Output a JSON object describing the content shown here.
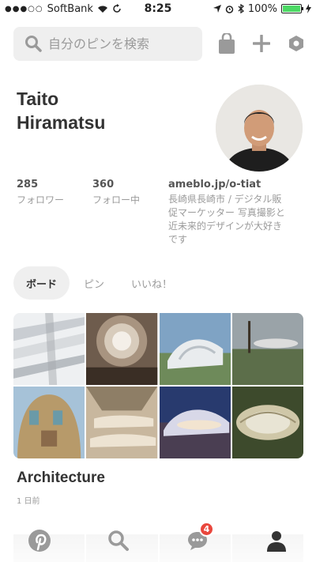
{
  "status_bar": {
    "signal": "●●●○○",
    "carrier": "SoftBank",
    "time": "8:25",
    "battery_percent": "100%",
    "battery_level": 1.0
  },
  "top_bar": {
    "search_placeholder": "自分のピンを検索",
    "icons": [
      "search-icon",
      "bag-icon",
      "plus-icon",
      "settings-hex-icon"
    ]
  },
  "profile": {
    "first_name": "Taito",
    "last_name": "Hiramatsu",
    "followers_count": "285",
    "followers_label": "フォロワー",
    "following_count": "360",
    "following_label": "フォロー中",
    "website": "ameblo.jp/o-tiat",
    "bio_lines": [
      "長崎県長崎市 / デジタル販",
      "促マーケッター 写真撮影と",
      "近未来的デザインが大好き",
      "です"
    ]
  },
  "tabs": [
    {
      "label": "ボード",
      "active": true
    },
    {
      "label": "ピン",
      "active": false
    },
    {
      "label": "いいね！",
      "active": false
    }
  ],
  "board": {
    "title": "Architecture",
    "meta": "1 日前"
  },
  "bottom_nav": {
    "items": [
      "pinterest-icon",
      "search-icon",
      "chat-icon",
      "profile-icon"
    ],
    "chat_badge": "4"
  },
  "colors": {
    "accent_red": "#e9463c",
    "battery_green": "#4cd964",
    "search_bg": "#efefef"
  }
}
